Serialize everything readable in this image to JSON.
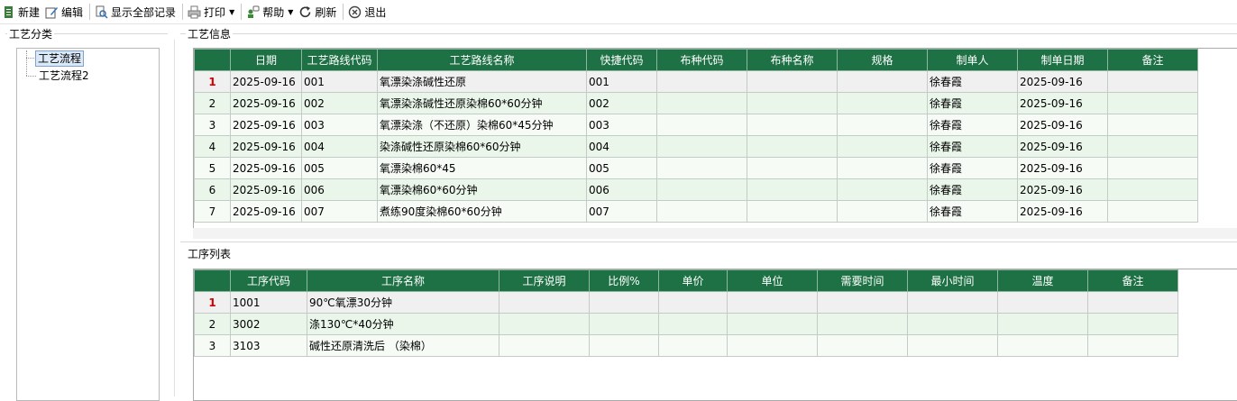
{
  "toolbar": {
    "new_label": "新建",
    "edit_label": "编辑",
    "show_all_label": "显示全部记录",
    "print_label": "打印",
    "help_label": "帮助",
    "refresh_label": "刷新",
    "exit_label": "退出"
  },
  "sections": {
    "category_title": "工艺分类",
    "info_title": "工艺信息",
    "process_title": "工序列表"
  },
  "tree": {
    "items": [
      {
        "label": "工艺流程"
      },
      {
        "label": "工艺流程2"
      }
    ]
  },
  "routes": {
    "headers": [
      "",
      "日期",
      "工艺路线代码",
      "工艺路线名称",
      "快捷代码",
      "布种代码",
      "布种名称",
      "规格",
      "制单人",
      "制单日期",
      "备注"
    ],
    "rows": [
      {
        "n": "1",
        "date": "2025-09-16",
        "code": "001",
        "name": "氧漂染涤碱性还原",
        "quick": "001",
        "cloth_code": "",
        "cloth_name": "",
        "spec": "",
        "maker": "徐春霞",
        "make_date": "2025-09-16",
        "note": ""
      },
      {
        "n": "2",
        "date": "2025-09-16",
        "code": "002",
        "name": "氧漂染涤碱性还原染棉60*60分钟",
        "quick": "002",
        "cloth_code": "",
        "cloth_name": "",
        "spec": "",
        "maker": "徐春霞",
        "make_date": "2025-09-16",
        "note": ""
      },
      {
        "n": "3",
        "date": "2025-09-16",
        "code": "003",
        "name": "氧漂染涤（不还原）染棉60*45分钟",
        "quick": "003",
        "cloth_code": "",
        "cloth_name": "",
        "spec": "",
        "maker": "徐春霞",
        "make_date": "2025-09-16",
        "note": ""
      },
      {
        "n": "4",
        "date": "2025-09-16",
        "code": "004",
        "name": "染涤碱性还原染棉60*60分钟",
        "quick": "004",
        "cloth_code": "",
        "cloth_name": "",
        "spec": "",
        "maker": "徐春霞",
        "make_date": "2025-09-16",
        "note": ""
      },
      {
        "n": "5",
        "date": "2025-09-16",
        "code": "005",
        "name": "氧漂染棉60*45",
        "quick": "005",
        "cloth_code": "",
        "cloth_name": "",
        "spec": "",
        "maker": "徐春霞",
        "make_date": "2025-09-16",
        "note": ""
      },
      {
        "n": "6",
        "date": "2025-09-16",
        "code": "006",
        "name": "氧漂染棉60*60分钟",
        "quick": "006",
        "cloth_code": "",
        "cloth_name": "",
        "spec": "",
        "maker": "徐春霞",
        "make_date": "2025-09-16",
        "note": ""
      },
      {
        "n": "7",
        "date": "2025-09-16",
        "code": "007",
        "name": "煮练90度染棉60*60分钟",
        "quick": "007",
        "cloth_code": "",
        "cloth_name": "",
        "spec": "",
        "maker": "徐春霞",
        "make_date": "2025-09-16",
        "note": ""
      }
    ]
  },
  "processes": {
    "headers": [
      "",
      "工序代码",
      "工序名称",
      "工序说明",
      "比例%",
      "单价",
      "单位",
      "需要时间",
      "最小时间",
      "温度",
      "备注"
    ],
    "rows": [
      {
        "n": "1",
        "code": "1001",
        "name": "90℃氧漂30分钟",
        "desc": "",
        "ratio": "",
        "price": "",
        "unit": "",
        "need_time": "",
        "min_time": "",
        "temp": "",
        "note": ""
      },
      {
        "n": "2",
        "code": "3002",
        "name": "涤130℃*40分钟",
        "desc": "",
        "ratio": "",
        "price": "",
        "unit": "",
        "need_time": "",
        "min_time": "",
        "temp": "",
        "note": ""
      },
      {
        "n": "3",
        "code": "3103",
        "name": "碱性还原清洗后 （染棉）",
        "desc": "",
        "ratio": "",
        "price": "",
        "unit": "",
        "need_time": "",
        "min_time": "",
        "temp": "",
        "note": ""
      }
    ]
  },
  "colors": {
    "header_green": "#1e7145",
    "row_alt": "#eaf6ea",
    "selected_row_number": "#d40000"
  }
}
